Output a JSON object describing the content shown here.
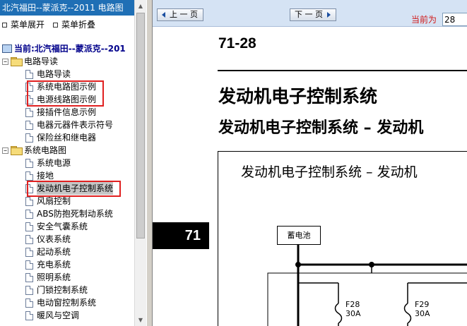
{
  "left_pane": {
    "title": "北汽福田--蒙派克--2011 电路图",
    "expand_label": "菜单展开",
    "collapse_label": "菜单折叠",
    "root_label": "当前:北汽福田--蒙派克--201",
    "tree": {
      "group1": {
        "label": "电路导读",
        "items": [
          "电路导读",
          "系统电路图示例",
          "电源线路图示例",
          "接插件信息示例",
          "电器元器件表示符号",
          "保险丝和继电器"
        ]
      },
      "group2": {
        "label": "系统电路图",
        "items": [
          "系统电源",
          "接地",
          "发动机电子控制系统",
          "风扇控制",
          "ABS防抱死制动系统",
          "安全气囊系统",
          "仪表系统",
          "起动系统",
          "充电系统",
          "照明系统",
          "门锁控制系统",
          "电动窗控制系统",
          "暖风与空调"
        ]
      },
      "selected": "发动机电子控制系统"
    }
  },
  "toolbar": {
    "prev_label": "上 一 页",
    "next_label": "下 一 页",
    "current_label": "当前为",
    "current_value": "28"
  },
  "document": {
    "page_number": "71-28",
    "heading": "发动机电子控制系统",
    "subheading": "发动机电子控制系统 – 发动机",
    "side_tab": "71",
    "diagram": {
      "title": "发动机电子控制系统 – 发动机",
      "battery_label": "蓄电池",
      "fuses": [
        {
          "name": "F28",
          "rating": "30A"
        },
        {
          "name": "F29",
          "rating": "30A"
        }
      ]
    }
  },
  "colors": {
    "title_bar": "#1f6fb5",
    "toolbar_bg": "#d5e3f4",
    "highlight_box": "#e02020",
    "current_label": "#d01818"
  }
}
